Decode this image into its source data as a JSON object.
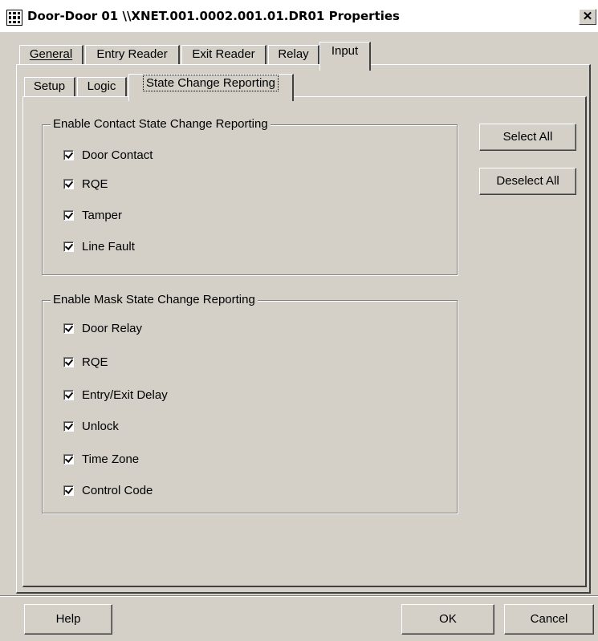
{
  "window": {
    "title": "Door-Door 01 \\\\XNET.001.0002.001.01.DR01 Properties",
    "close_label": "✕"
  },
  "tabs": [
    {
      "label": "General",
      "active": false
    },
    {
      "label": "Entry Reader",
      "active": false
    },
    {
      "label": "Exit Reader",
      "active": false
    },
    {
      "label": "Relay",
      "active": false
    },
    {
      "label": "Input",
      "active": true
    }
  ],
  "subtabs": [
    {
      "label": "Setup",
      "active": false
    },
    {
      "label": "Logic",
      "active": false
    },
    {
      "label": "State Change Reporting",
      "active": true
    }
  ],
  "contact_group": {
    "title": "Enable Contact State Change Reporting",
    "items": [
      {
        "label": "Door Contact",
        "checked": true
      },
      {
        "label": "RQE",
        "checked": true
      },
      {
        "label": "Tamper",
        "checked": true
      },
      {
        "label": "Line Fault",
        "checked": true
      }
    ]
  },
  "mask_group": {
    "title": "Enable Mask State Change Reporting",
    "items": [
      {
        "label": "Door Relay",
        "checked": true
      },
      {
        "label": "RQE",
        "checked": true
      },
      {
        "label": "Entry/Exit Delay",
        "checked": true
      },
      {
        "label": "Unlock",
        "checked": true
      },
      {
        "label": "Time Zone",
        "checked": true
      },
      {
        "label": "Control Code",
        "checked": true
      }
    ]
  },
  "side_buttons": {
    "select_all": "Select All",
    "deselect_all": "Deselect All"
  },
  "footer": {
    "help": "Help",
    "ok": "OK",
    "cancel": "Cancel"
  }
}
